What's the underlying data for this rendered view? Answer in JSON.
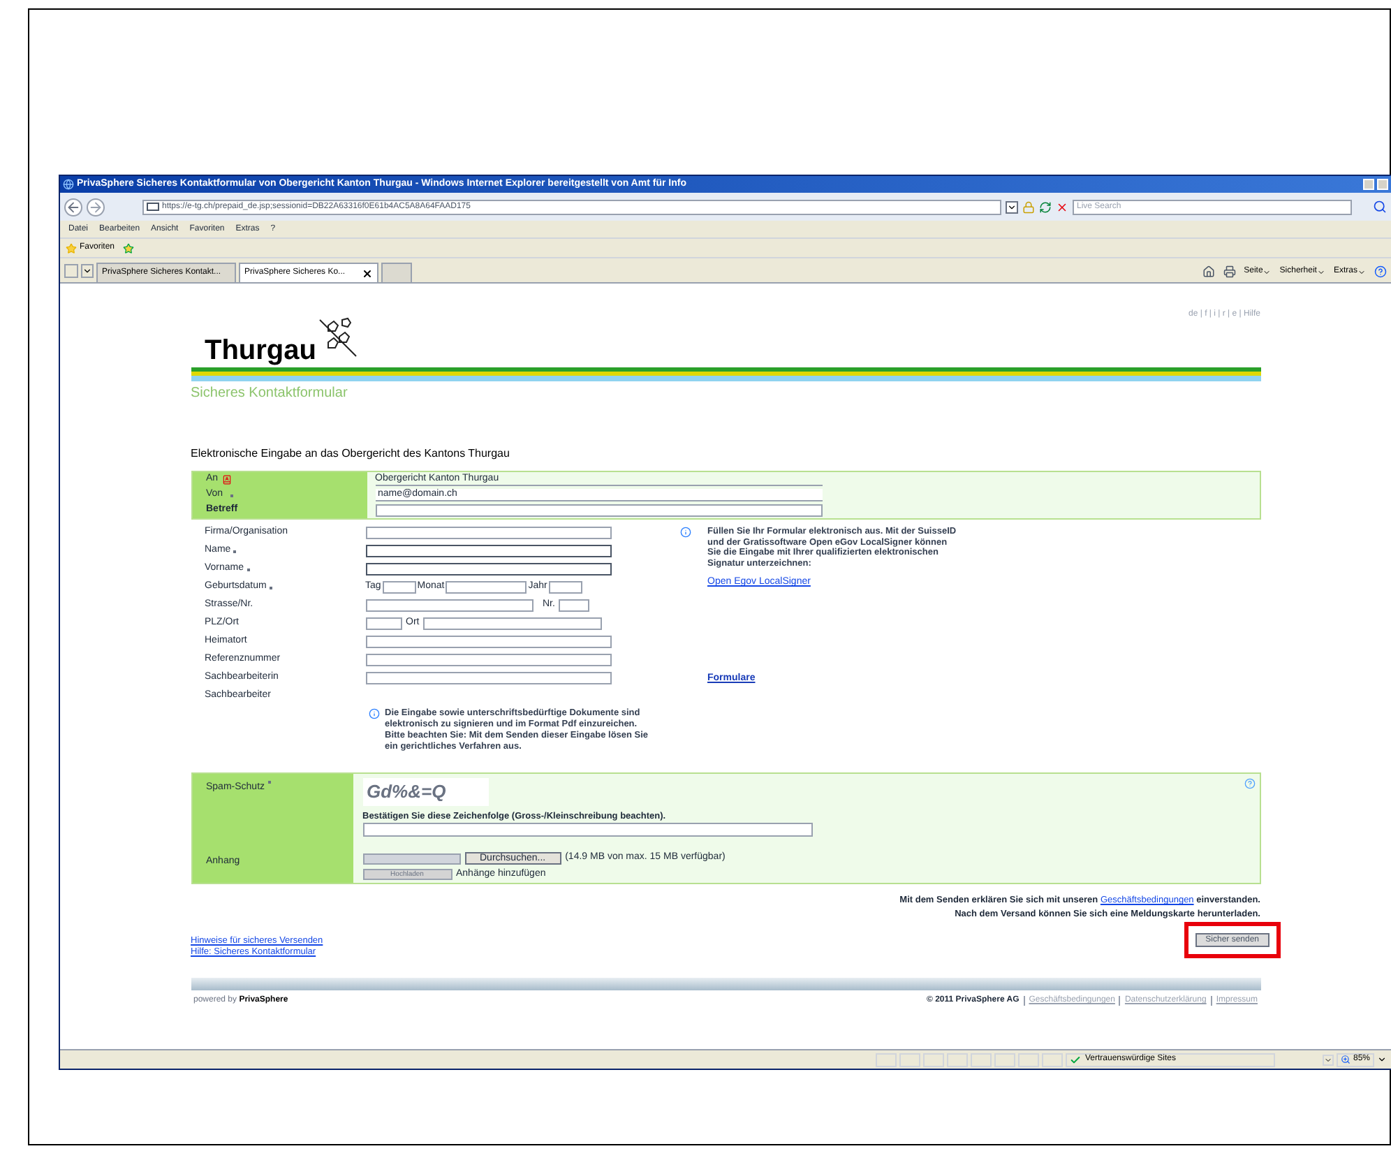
{
  "window": {
    "title": "PrivaSphere Sicheres Kontaktformular von Obergericht Kanton Thurgau - Windows Internet Explorer bereitgestellt von Amt für Info"
  },
  "address_bar": {
    "url": "https://e-tg.ch/prepaid_de.jsp;sessionid=DB22A63316f0E61b4AC5A8A64FAAD175",
    "search_placeholder": "Live Search"
  },
  "menu": [
    "Datei",
    "Bearbeiten",
    "Ansicht",
    "Favoriten",
    "Extras",
    "?"
  ],
  "favorites_label": "Favoriten",
  "tabs": [
    {
      "label": "PrivaSphere Sicheres Kontakt...",
      "selected": false
    },
    {
      "label": "PrivaSphere Sicheres Ko...",
      "selected": true
    }
  ],
  "command_bar": [
    "Seite",
    "Sicherheit",
    "Extras"
  ],
  "page": {
    "logo": "Thurgau",
    "languages": "de | f | i | r | e | Hilfe",
    "subtitle": "Sicheres Kontaktformular",
    "heading": "Elektronische Eingabe an das Obergericht des Kantons Thurgau",
    "header_fields": [
      {
        "label": "An",
        "kind": "static",
        "value": "Obergericht Kanton Thurgau"
      },
      {
        "label": "Von",
        "kind": "input",
        "required": true,
        "value": "name@domain.ch"
      },
      {
        "label": "Betreff",
        "kind": "input",
        "bold": true
      }
    ],
    "fields": [
      {
        "label": "Firma/Organisation",
        "kind": "text"
      },
      {
        "label": "Name",
        "kind": "text",
        "required": true
      },
      {
        "label": "Vorname",
        "kind": "text",
        "required": true
      },
      {
        "label": "Geburtsdatum",
        "kind": "date",
        "required": true,
        "parts": [
          "Tag",
          "Monat",
          "Jahr"
        ]
      },
      {
        "label": "Strasse/Nr.",
        "kind": "street",
        "parts": [
          "Nr."
        ]
      },
      {
        "label": "PLZ/Ort",
        "kind": "city",
        "parts": [
          "Ort"
        ]
      },
      {
        "label": "Heimatort",
        "kind": "text"
      },
      {
        "label": "Referenznummer",
        "kind": "text"
      },
      {
        "label": "Sachbearbeiterin",
        "kind": "text"
      },
      {
        "label": "Sachbearbeiter",
        "kind": "none"
      }
    ],
    "info_text": "Füllen Sie Ihr Formular elektronisch aus. Mit der SuisseID und der Gratissoftware Open eGov LocalSigner können Sie die Eingabe mit Ihrer qualifizierten elektronischen Signatur unterzeichnen:",
    "info_link": "Open Egov LocalSigner",
    "forms_link": "Formulare",
    "note": "Die Eingabe sowie unterschriftsbedürftige Dokumente sind elektronisch zu signieren und im Format Pdf einzureichen. Bitte beachten Sie: Mit dem Senden dieser Eingabe lösen Sie ein gerichtliches Verfahren aus.",
    "spam": {
      "label": "Spam-Schutz",
      "required": true,
      "captcha": "Gd%&=Q",
      "instruction": "Bestätigen Sie diese Zeichenfolge (Gross-/Kleinschreibung beachten)."
    },
    "attachment": {
      "label": "Anhang",
      "browse_button": "Durchsuchen...",
      "quota": "(14.9 MB von max. 15 MB verfügbar)",
      "upload_button": "Hochladen",
      "add_label": "Anhänge hinzufügen"
    },
    "terms": {
      "before": "Mit dem Senden erklären Sie sich mit unseren",
      "link": "Geschäftsbedingungen",
      "after": "einverstanden."
    },
    "terms_note": "Nach dem Versand können Sie sich eine Meldungskarte herunterladen.",
    "send_button": {
      "label": "Sicher senden",
      "highlighted": true
    },
    "help_links": [
      "Hinweise für sicheres Versenden",
      "Hilfe: Sicheres Kontaktformular"
    ],
    "footer": {
      "powered_by": "powered by",
      "brand": "PrivaSphere",
      "copyright": "© 2011 PrivaSphere AG",
      "links": [
        "Geschäftsbedingungen",
        "Datenschutzerklärung",
        "Impressum"
      ]
    }
  },
  "status_bar": {
    "zone": "Vertrauenswürdige Sites",
    "zoom": "85%"
  }
}
